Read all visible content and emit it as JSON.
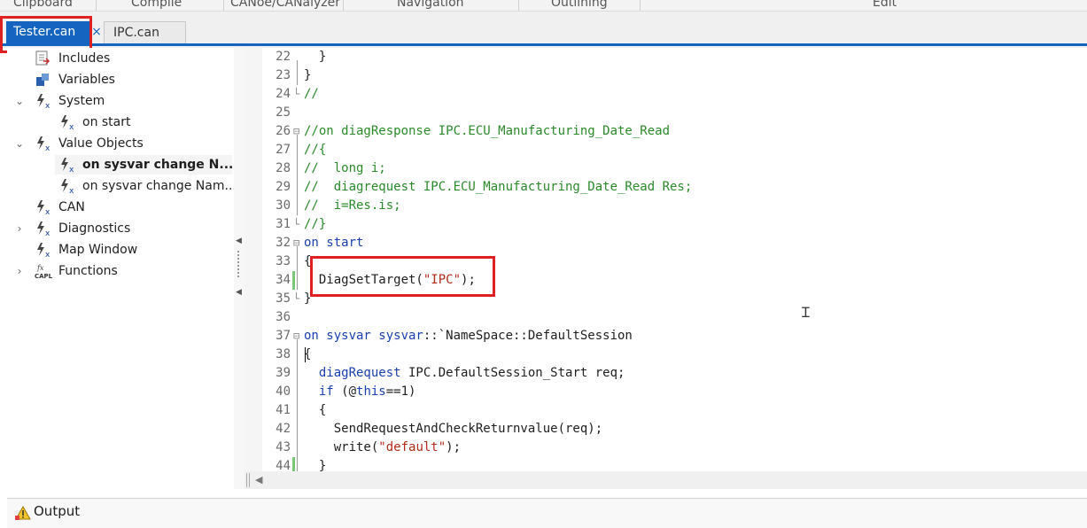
{
  "ribbon": {
    "groups": [
      "Clipboard",
      "Compile",
      "CANoe/CANalyzer",
      "Navigation",
      "Outlining",
      "Edit"
    ]
  },
  "tabs": [
    {
      "label": "Tester.can",
      "active": true
    },
    {
      "label": "IPC.can",
      "active": false
    }
  ],
  "tab_close_glyph": "×",
  "tree": {
    "nodes": [
      {
        "label": "Includes",
        "icon": "includes-icon"
      },
      {
        "label": "Variables",
        "icon": "variables-icon"
      },
      {
        "label": "System",
        "icon": "event-icon",
        "expanded": true
      },
      {
        "label": "on start",
        "icon": "event-icon"
      },
      {
        "label": "Value Objects",
        "icon": "event-icon",
        "expanded": true
      },
      {
        "label": "on sysvar change N...",
        "icon": "event-icon",
        "selected": true
      },
      {
        "label": "on sysvar change Nam...",
        "icon": "event-icon"
      },
      {
        "label": "CAN",
        "icon": "event-icon"
      },
      {
        "label": "Diagnostics",
        "icon": "event-icon",
        "expanded": false
      },
      {
        "label": "Map Window",
        "icon": "event-icon"
      },
      {
        "label": "Functions",
        "icon": "capl-functions-icon",
        "expanded": false
      }
    ]
  },
  "editor": {
    "lines": [
      {
        "n": "22",
        "code": "  }"
      },
      {
        "n": "23",
        "code": "}"
      },
      {
        "n": "24",
        "code": "//"
      },
      {
        "n": "25",
        "code": ""
      },
      {
        "n": "26",
        "code": "//on diagResponse IPC.ECU_Manufacturing_Date_Read"
      },
      {
        "n": "27",
        "code": "//{"
      },
      {
        "n": "28",
        "code": "//  long i;"
      },
      {
        "n": "29",
        "code": "//  diagrequest IPC.ECU_Manufacturing_Date_Read Res;"
      },
      {
        "n": "30",
        "code": "//  i=Res.is;"
      },
      {
        "n": "31",
        "code": "//}"
      },
      {
        "n": "32",
        "code_kw": "on start"
      },
      {
        "n": "33",
        "code": "{"
      },
      {
        "n": "34",
        "code_pre": "  DiagSetTarget(",
        "code_str": "\"IPC\"",
        "code_post": ");"
      },
      {
        "n": "35",
        "code": "}"
      },
      {
        "n": "36",
        "code": ""
      },
      {
        "n": "37",
        "code_kw": "on sysvar sysvar",
        "code_post": "::`NameSpace::DefaultSession"
      },
      {
        "n": "38",
        "code": "{"
      },
      {
        "n": "39",
        "code_kwi": "  diagRequest",
        "code_post": " IPC.DefaultSession_Start req;"
      },
      {
        "n": "40",
        "code_kwi": "  if",
        "code_post": " (@",
        "code_kw2": "this",
        "code_post2": "==1)"
      },
      {
        "n": "41",
        "code": "  {"
      },
      {
        "n": "42",
        "code": "    SendRequestAndCheckReturnvalue(req);"
      },
      {
        "n": "43",
        "code_pre": "    write(",
        "code_str": "\"default\"",
        "code_post": ");"
      },
      {
        "n": "44",
        "code": "  }"
      }
    ]
  },
  "output": {
    "label": "Output"
  }
}
